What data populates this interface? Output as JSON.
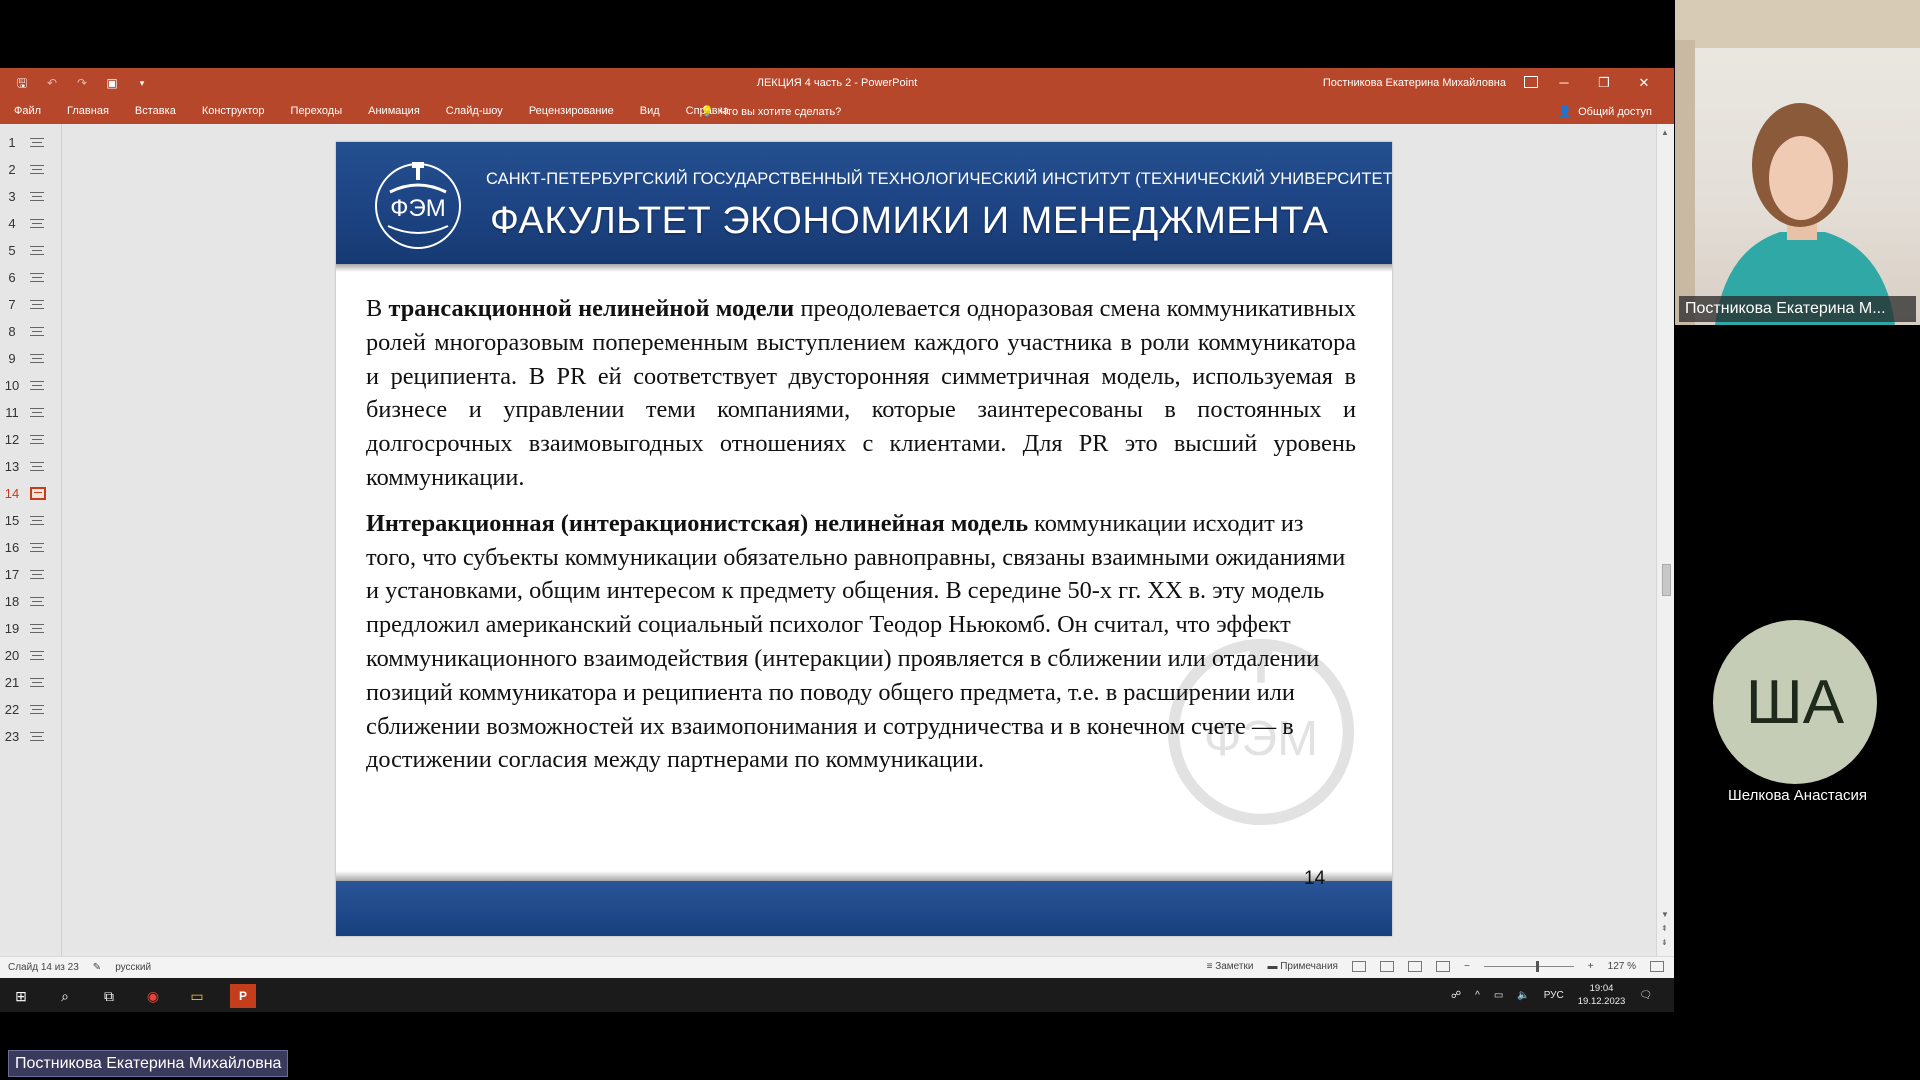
{
  "powerpoint": {
    "window_title": "ЛЕКЦИЯ 4  часть 2  -  PowerPoint",
    "user_name": "Постникова Екатерина Михайловна",
    "menu_tabs": [
      "Файл",
      "Главная",
      "Вставка",
      "Конструктор",
      "Переходы",
      "Анимация",
      "Слайд-шоу",
      "Рецензирование",
      "Вид",
      "Справка"
    ],
    "tell_me": "Что вы хотите сделать?",
    "share": "Общий доступ",
    "thumbnails": [
      "1",
      "2",
      "3",
      "4",
      "5",
      "6",
      "7",
      "8",
      "9",
      "10",
      "11",
      "12",
      "13",
      "14",
      "15",
      "16",
      "17",
      "18",
      "19",
      "20",
      "21",
      "22",
      "23"
    ],
    "active_slide": "14"
  },
  "slide": {
    "institute": "САНКТ-ПЕТЕРБУРГСКИЙ ГОСУДАРСТВЕННЫЙ ТЕХНОЛОГИЧЕСКИЙ ИНСТИТУТ (ТЕХНИЧЕСКИЙ УНИВЕРСИТЕТ)",
    "faculty": "ФАКУЛЬТЕТ ЭКОНОМИКИ И МЕНЕДЖМЕНТА",
    "logo_text": "ФЭМ",
    "p1_pre": "В ",
    "p1_bold": "трансакционной нелинейной модели",
    "p1_rest": " преодолевается одноразовая смена коммуникативных ролей многоразовым попеременным выступлением каждого участника в роли коммуникатора и реципиента. В PR ей соответствует двусторонняя симметричная модель, используемая в бизнесе и управлении теми компаниями, которые заинтересованы в постоянных и долгосрочных взаимовыгодных отношениях с клиентами. Для PR это высший уровень коммуникации.",
    "p2_bold": "Интеракционная (интеракционистская) нелинейная модель",
    "p2_rest": " коммуникации исходит из того, что субъекты коммуникации обязательно равноправны, связаны взаимными ожиданиями и установками, общим интересом к предмету общения. В середине 50-х гг. XX в. эту модель предложил американский социальный психолог Теодор Ньюкомб. Он считал, что эффект коммуникационного взаимодействия (интеракции) проявляется в сближении или отдалении позиций коммуникатора и реципиента по поводу общего предмета, т.е. в расширении или сближении возможностей их взаимопонимания и сотрудничества и в конечном счете — в достижении согласия между партнерами по коммуникации.",
    "number": "14"
  },
  "statusbar": {
    "slide_counter": "Слайд 14 из 23",
    "language": "русский",
    "notes": "Заметки",
    "comments": "Примечания",
    "zoom": "127 %"
  },
  "taskbar": {
    "lang": "РУС",
    "time": "19:04",
    "date": "19.12.2023"
  },
  "participants": {
    "presenter_cam_name": "Постникова Екатерина М...",
    "second_initials": "ША",
    "second_name": "Шелкова Анастасия",
    "presenter_full": "Постникова Екатерина Михайловна"
  },
  "colors": {
    "ppt_accent": "#b7472a",
    "slide_blue": "#1d4383",
    "active_thumb": "#c43e1c"
  }
}
